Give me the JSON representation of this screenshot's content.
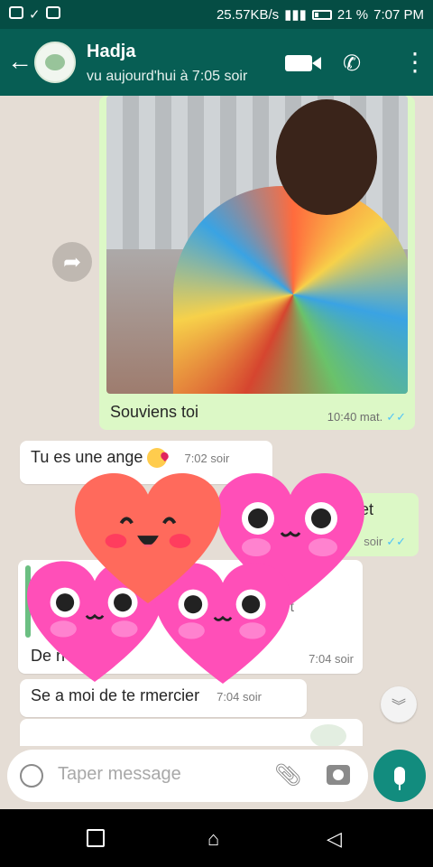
{
  "status_bar": {
    "speed": "25.57KB/s",
    "battery": "21 %",
    "time": "7:07 PM"
  },
  "header": {
    "contact_name": "Hadja",
    "last_seen": "vu aujourd'hui à 7:05 soir"
  },
  "messages": [
    {
      "type": "image_out",
      "caption": "Souviens toi",
      "time": "10:40 mat."
    },
    {
      "type": "text_in",
      "text": "Tu es une ange",
      "time": "7:02 soir"
    },
    {
      "type": "text_out_partial",
      "text": "et",
      "time": "soir"
    },
    {
      "type": "reply_in_partial",
      "text": "De n",
      "quoted": "t",
      "time": "7:04 soir"
    },
    {
      "type": "text_in",
      "text": "Se a moi de te rmercier",
      "time": "7:04 soir"
    }
  ],
  "input": {
    "placeholder": "Taper message"
  },
  "colors": {
    "header": "#075e54",
    "status_bar": "#054d44",
    "chat_bg": "#e5ddd5",
    "outgoing_bubble": "#dcf8c6",
    "incoming_bubble": "#ffffff",
    "mic_button": "#128c7e",
    "read_ticks": "#4fc3f7",
    "heart_pink": "#ff4fb8",
    "heart_red": "#ff6a5c"
  },
  "icons": {
    "back": "arrow-left-icon",
    "video": "video-call-icon",
    "call": "phone-icon",
    "menu": "more-vert-icon",
    "forward": "forward-icon",
    "scroll": "double-chevron-down-icon",
    "emoji": "emoji-icon",
    "attach": "paperclip-icon",
    "camera": "camera-icon",
    "mic": "mic-icon"
  }
}
